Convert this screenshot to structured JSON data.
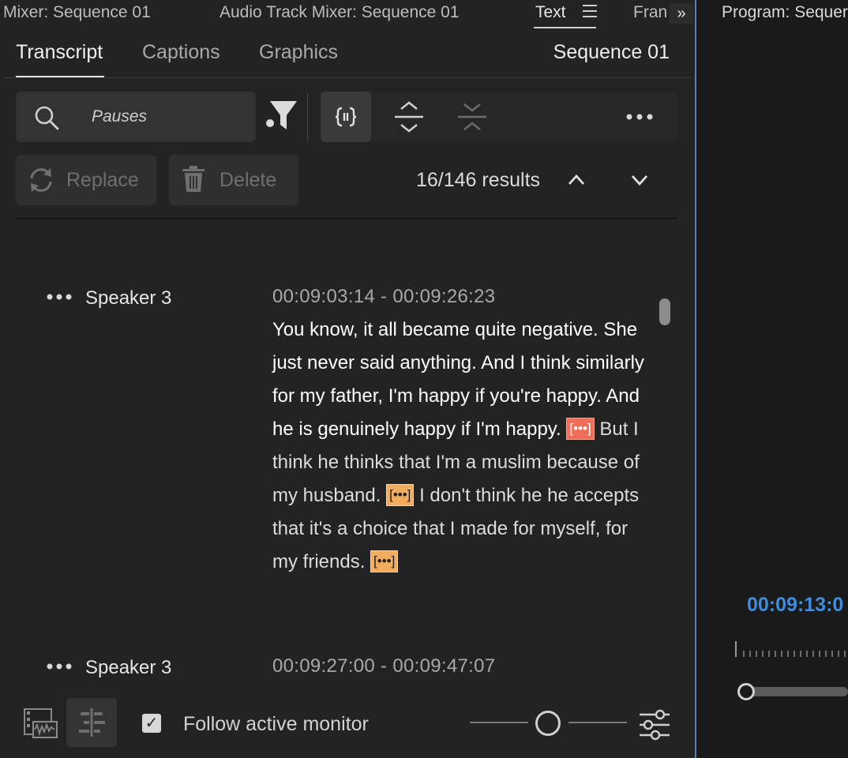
{
  "panel_tabs": [
    {
      "label": "Mixer: Sequence 01"
    },
    {
      "label": "Audio Track Mixer: Sequence 01"
    },
    {
      "label": "Text"
    },
    {
      "label": "Fran"
    }
  ],
  "overflow_label": "»",
  "sub_tabs": [
    {
      "label": "Transcript"
    },
    {
      "label": "Captions"
    },
    {
      "label": "Graphics"
    }
  ],
  "sequence_name": "Sequence 01",
  "search": {
    "placeholder": "Pauses"
  },
  "actions": {
    "replace_label": "Replace",
    "delete_label": "Delete"
  },
  "results": {
    "label": "16/146 results"
  },
  "transcript": [
    {
      "speaker": "Speaker 3",
      "timecode": "00:09:03:14 - 00:09:26:23",
      "text": {
        "s1": "You know, it all became quite negative. She just never said anything. And I think similarly for my father, I'm happy if you're happy. And he is genuinely happy if I'm happy. ",
        "s2": " But I think he thinks that I'm a muslim because of my husband. ",
        "s3": " I don't think he he accepts that it's a choice that I made for myself, for my friends. "
      }
    },
    {
      "speaker": "Speaker 3",
      "timecode": "00:09:27:00 - 00:09:47:07"
    }
  ],
  "pause_marker": "[•••]",
  "footer": {
    "follow_label": "Follow active monitor",
    "follow_checked": true
  },
  "program_monitor": {
    "tab_label": "Program: Sequer",
    "timecode": "00:09:13:0"
  },
  "colors": {
    "pause_active": "#ee6e58",
    "pause": "#f3ab5e",
    "timecode_blue": "#3d8de0"
  }
}
